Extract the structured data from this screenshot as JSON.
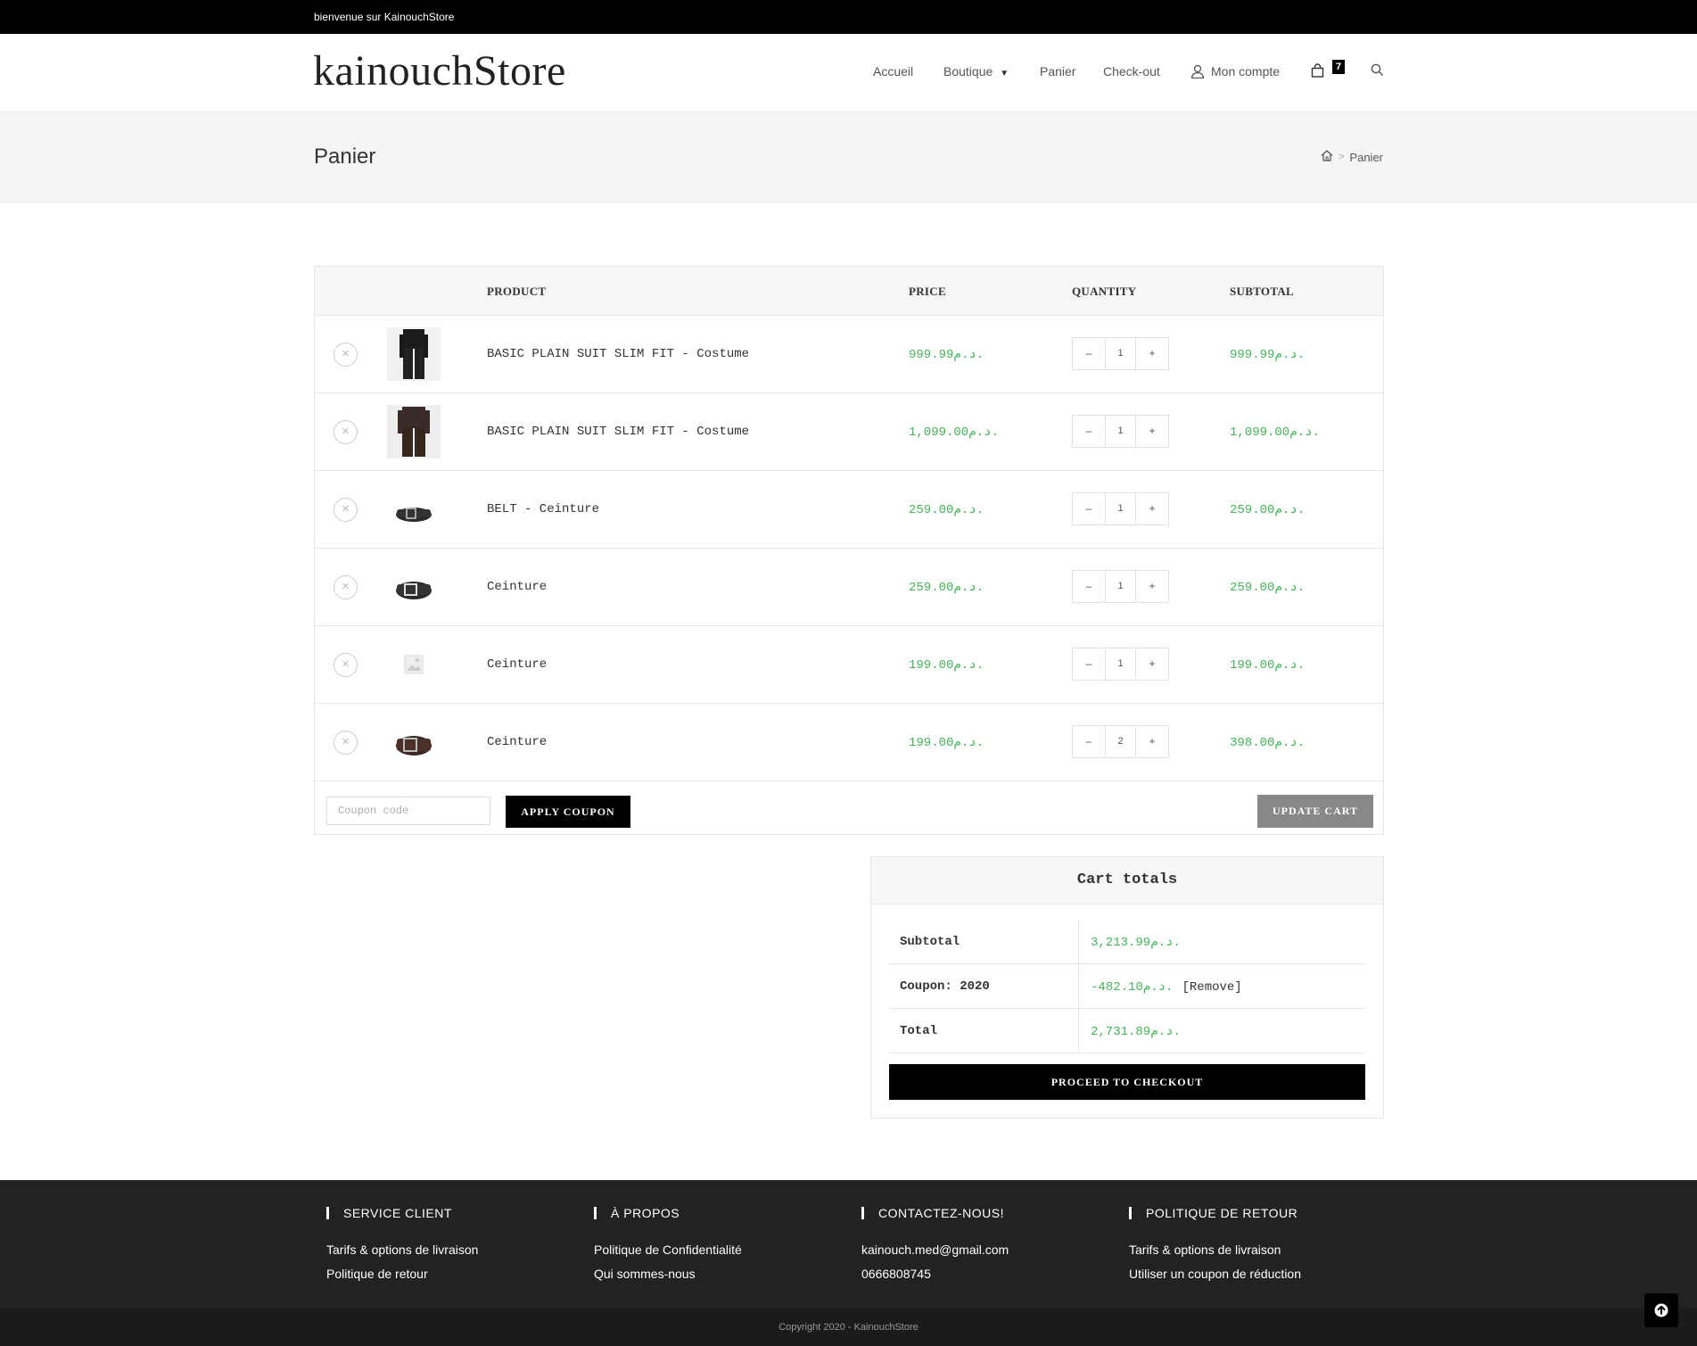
{
  "topbar": {
    "welcome": "bienvenue sur KainouchStore"
  },
  "header": {
    "logo": "kainouchStore",
    "nav": {
      "home": "Accueil",
      "shop": "Boutique",
      "cart": "Panier",
      "checkout": "Check-out",
      "account": "Mon compte",
      "cart_count": "7"
    }
  },
  "page": {
    "title": "Panier",
    "breadcrumb": "Panier"
  },
  "cart": {
    "columns": {
      "product": "PRODUCT",
      "price": "PRICE",
      "quantity": "QUANTITY",
      "subtotal": "SUBTOTAL"
    },
    "items": [
      {
        "name": "BASIC PLAIN SUIT SLIM FIT - Costume",
        "price": "999.99د.م.",
        "qty": "1",
        "subtotal": "999.99د.م.",
        "thumb": "suit-black"
      },
      {
        "name": "BASIC PLAIN SUIT SLIM FIT - Costume",
        "price": "1,099.00د.م.",
        "qty": "1",
        "subtotal": "1,099.00د.م.",
        "thumb": "suit-brown"
      },
      {
        "name": "BELT - Ceinture",
        "price": "259.00د.م.",
        "qty": "1",
        "subtotal": "259.00د.م.",
        "thumb": "belt-black"
      },
      {
        "name": "Ceinture",
        "price": "259.00د.م.",
        "qty": "1",
        "subtotal": "259.00د.م.",
        "thumb": "belt-black"
      },
      {
        "name": "Ceinture",
        "price": "199.00د.م.",
        "qty": "1",
        "subtotal": "199.00د.م.",
        "thumb": "placeholder"
      },
      {
        "name": "Ceinture",
        "price": "199.00د.م.",
        "qty": "2",
        "subtotal": "398.00د.م.",
        "thumb": "belt-brown"
      }
    ],
    "coupon_placeholder": "Coupon code",
    "apply_coupon": "APPLY COUPON",
    "update_cart": "UPDATE CART"
  },
  "totals": {
    "title": "Cart totals",
    "subtotal_label": "Subtotal",
    "subtotal_value": "3,213.99د.م.",
    "coupon_label": "Coupon: 2020",
    "coupon_value": "-482.10د.م.",
    "coupon_remove": "[Remove]",
    "total_label": "Total",
    "total_value": "2,731.89د.م.",
    "checkout": "PROCEED TO CHECKOUT"
  },
  "footer": {
    "columns": [
      {
        "title": "SERVICE CLIENT",
        "links": [
          "Tarifs & options de livraison",
          "Politique de retour"
        ]
      },
      {
        "title": "À PROPOS",
        "links": [
          "Politique de Confidentialité",
          "Qui sommes-nous"
        ]
      },
      {
        "title": "CONTACTEZ-NOUS!",
        "links": [
          "kainouch.med@gmail.com",
          "0666808745"
        ]
      },
      {
        "title": "POLITIQUE DE RETOUR",
        "links": [
          "Tarifs & options de livraison",
          "Utiliser un coupon de réduction"
        ]
      }
    ],
    "copyright": "Copyright 2020 - KainouchStore"
  },
  "colors": {
    "accent_price": "#47b35b",
    "topbar": "#000000",
    "footer": "#222222"
  }
}
